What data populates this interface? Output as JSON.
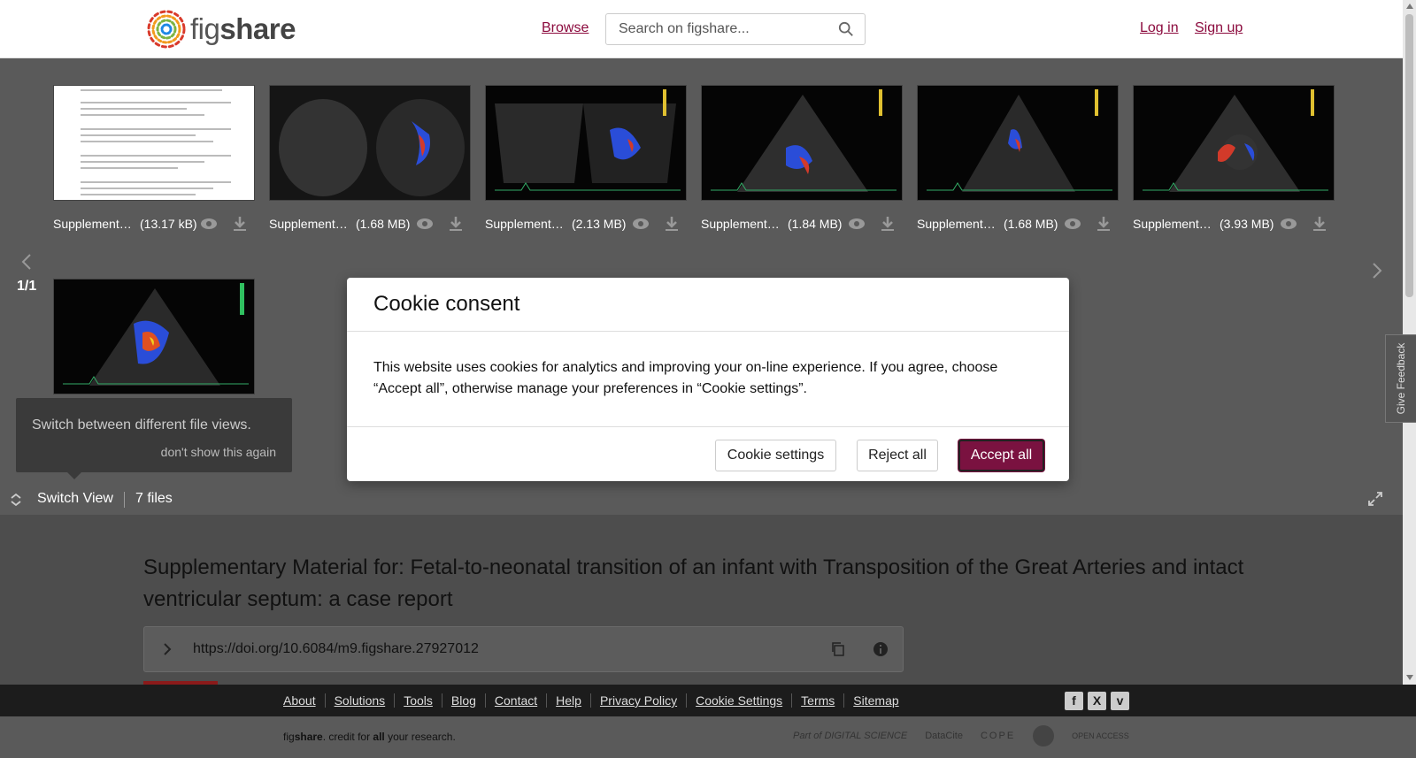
{
  "header": {
    "logo_text_light": "fig",
    "logo_text_bold": "share",
    "browse": "Browse",
    "search_placeholder": "Search on figshare...",
    "login": "Log in",
    "signup": "Sign up"
  },
  "viewer": {
    "files": [
      {
        "name": "Supplementary...",
        "size": "(13.17 kB)",
        "kind": "document"
      },
      {
        "name": "Supplementary...",
        "size": "(1.68 MB)",
        "kind": "echo"
      },
      {
        "name": "Supplementary...",
        "size": "(2.13 MB)",
        "kind": "echo"
      },
      {
        "name": "Supplementary...",
        "size": "(1.84 MB)",
        "kind": "echo"
      },
      {
        "name": "Supplementary...",
        "size": "(1.68 MB)",
        "kind": "echo"
      },
      {
        "name": "Supplementary...",
        "size": "(3.93 MB)",
        "kind": "echo"
      },
      {
        "name": "",
        "size": "",
        "kind": "echo"
      }
    ],
    "pager": "1/1",
    "tooltip_text": "Switch between different file views.",
    "tooltip_dismiss": "don't show this again",
    "switch_view": "Switch View",
    "files_count": "7 files"
  },
  "content": {
    "title": "Supplementary Material for: Fetal-to-neonatal transition of an infant with Transposition of the Great Arteries and intact ventricular septum: a case report",
    "doi": "https://doi.org/10.6084/m9.figshare.27927012"
  },
  "feedback": "Give Feedback",
  "footer": {
    "links": [
      "About",
      "Solutions",
      "Tools",
      "Blog",
      "Contact",
      "Help",
      "Privacy Policy",
      "Cookie Settings",
      "Terms",
      "Sitemap"
    ],
    "social": [
      "f",
      "X",
      "v"
    ],
    "tagline_light1": "fig",
    "tagline_bold1": "share",
    "tagline_mid": ". credit for ",
    "tagline_bold2": "all",
    "tagline_end": " your research.",
    "partners": [
      "Part of DIGITAL SCIENCE",
      "DataCite",
      "COPE",
      "OPEN ACCESS"
    ]
  },
  "cookie_modal": {
    "title": "Cookie consent",
    "body": "This website uses cookies for analytics and improving your on-line experience. If you agree, choose “Accept all”, otherwise manage your preferences in “Cookie settings”.",
    "settings_button": "Cookie settings",
    "reject_button": "Reject all",
    "accept_button": "Accept all"
  },
  "colors": {
    "brand": "#8b0a3d",
    "accept": "#7a1240"
  }
}
